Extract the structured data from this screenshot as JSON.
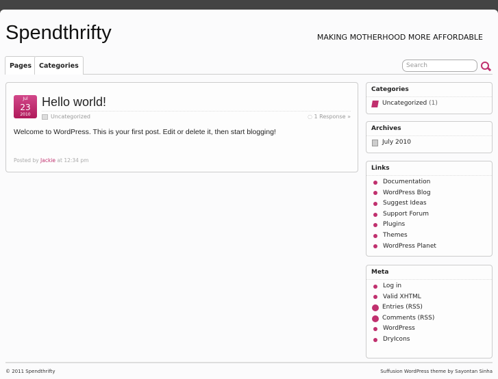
{
  "site": {
    "title": "Spendthrifty",
    "tagline": "MAKING MOTHERHOOD MORE AFFORDABLE"
  },
  "nav": {
    "tabs": [
      "Pages",
      "Categories"
    ],
    "search_placeholder": "Search"
  },
  "post": {
    "month": "Jul",
    "day": "23",
    "year": "2010",
    "title": "Hello world!",
    "category": "Uncategorized",
    "responses": "1 Response »",
    "body": "Welcome to WordPress. This is your first post. Edit or delete it, then start blogging!",
    "posted_by": "Posted by",
    "author": "Jackie",
    "time": "at 12:34 pm"
  },
  "sidebar": {
    "categories": {
      "title": "Categories",
      "item": "Uncategorized",
      "count": "(1)"
    },
    "archives": {
      "title": "Archives",
      "item": "July 2010"
    },
    "links": {
      "title": "Links",
      "items": [
        "Documentation",
        "WordPress Blog",
        "Suggest Ideas",
        "Support Forum",
        "Plugins",
        "Themes",
        "WordPress Planet"
      ]
    },
    "meta": {
      "title": "Meta",
      "items": [
        "Log in",
        "Valid XHTML",
        "Entries (RSS)",
        "Comments (RSS)",
        "WordPress",
        "DryIcons"
      ]
    }
  },
  "footer": {
    "left": "© 2011 Spendthrifty",
    "right": "Suffusion WordPress theme by Sayontan Sinha"
  },
  "colors": {
    "accent": "#c0306e"
  }
}
